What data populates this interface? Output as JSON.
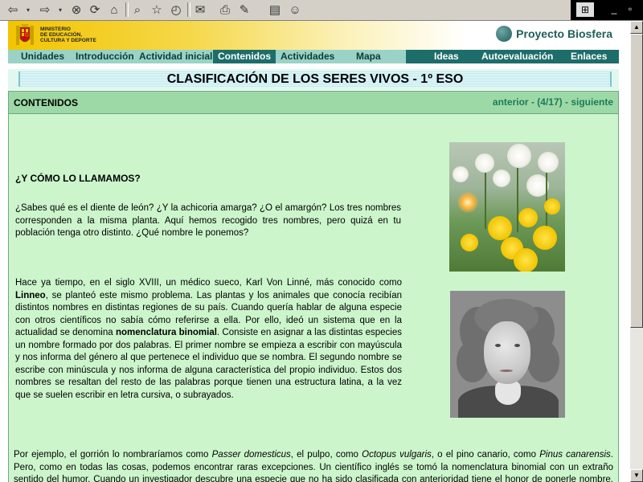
{
  "browser": {
    "toolbar_icons": [
      "back-icon",
      "back-dropdown-icon",
      "forward-icon",
      "forward-dropdown-icon",
      "stop-icon",
      "refresh-icon",
      "home-icon",
      "search-icon",
      "favorites-icon",
      "history-icon",
      "mail-icon",
      "print-icon",
      "edit-icon",
      "discuss-icon",
      "messenger-icon"
    ]
  },
  "header": {
    "ministry_line1": "MINISTERIO",
    "ministry_line2": "DE EDUCACIÓN,",
    "ministry_line3": "CULTURA Y DEPORTE",
    "brand": "Proyecto Biosfera"
  },
  "nav": {
    "items": [
      {
        "label": "Unidades"
      },
      {
        "label": "Introducción"
      },
      {
        "label": "Actividad inicial"
      },
      {
        "label": "Contenidos",
        "active": true
      },
      {
        "label": "Actividades"
      },
      {
        "label": "Mapa"
      },
      {
        "label": "Ideas"
      },
      {
        "label": "Autoevaluación"
      },
      {
        "label": "Enlaces"
      }
    ]
  },
  "page_title": "CLASIFICACIÓN DE LOS SERES VIVOS - 1º ESO",
  "content": {
    "section_label": "CONTENIDOS",
    "pager": {
      "prev": "anterior",
      "sep1": " - ",
      "position": "(4/17)",
      "sep2": " - ",
      "next": "siguiente"
    },
    "heading": "¿Y CÓMO LO LLAMAMOS?",
    "para1": "¿Sabes qué es el diente de león? ¿Y la achicoria amarga? ¿O el amargón? Los tres nombres corresponden a la misma planta. Aquí hemos recogido tres nombres, pero quizá en tu población tenga otro distinto. ¿Qué nombre le ponemos?",
    "para2": {
      "t1": "Hace ya tiempo, en el siglo XVIII, un médico sueco, Karl Von Linné, más conocido como ",
      "b1": "Linneo",
      "t2": ", se planteó este mismo problema. Las plantas y los animales que conocía recibían distintos nombres en distintas regiones de su país. Cuando quería hablar de alguna especie con otros científicos no sabía cómo referirse a ella. Por ello, ideó un sistema que en la actualidad se denomina ",
      "b2": "nomenclatura binomial",
      "t3": ". Consiste en asignar a las distintas especies un nombre formado por dos palabras. El primer nombre se empieza a escribir con mayúscula y nos informa del género al que pertenece el individuo que se nombra. El segundo nombre se escribe con minúscula y nos informa de alguna característica del propio individuo. Estos dos nombres se resaltan del resto de las palabras porque tienen una estructura latina, a la vez que se suelen escribir en letra cursiva, o subrayados."
    },
    "para3": {
      "t1": "Por ejemplo, el gorrión lo nombraríamos como ",
      "i1": "Passer domesticus",
      "t2": ", el pulpo, como ",
      "i2": "Octopus vulgaris",
      "t3": ", o el pino canario, como ",
      "i3": "Pinus canarensis",
      "t4": ". Pero, como en todas las cosas, podemos encontrar raras excepciones. Un científico inglés se tomó la nomenclatura binomial con un extraño sentido del humor. Cuando un investigador descubre una especie que no ha sido clasificada con anterioridad tiene el honor de ponerle nombre. Este investigador inglés puso nombre a varias especies de"
    }
  },
  "colors": {
    "nav_bg": "#9ad3c6",
    "nav_active": "#1d6d6a",
    "content_bg": "#ccf5cc",
    "content_head": "#9dd9a6",
    "pager_text": "#1d7a5b",
    "brand_text": "#1f5e5a"
  }
}
